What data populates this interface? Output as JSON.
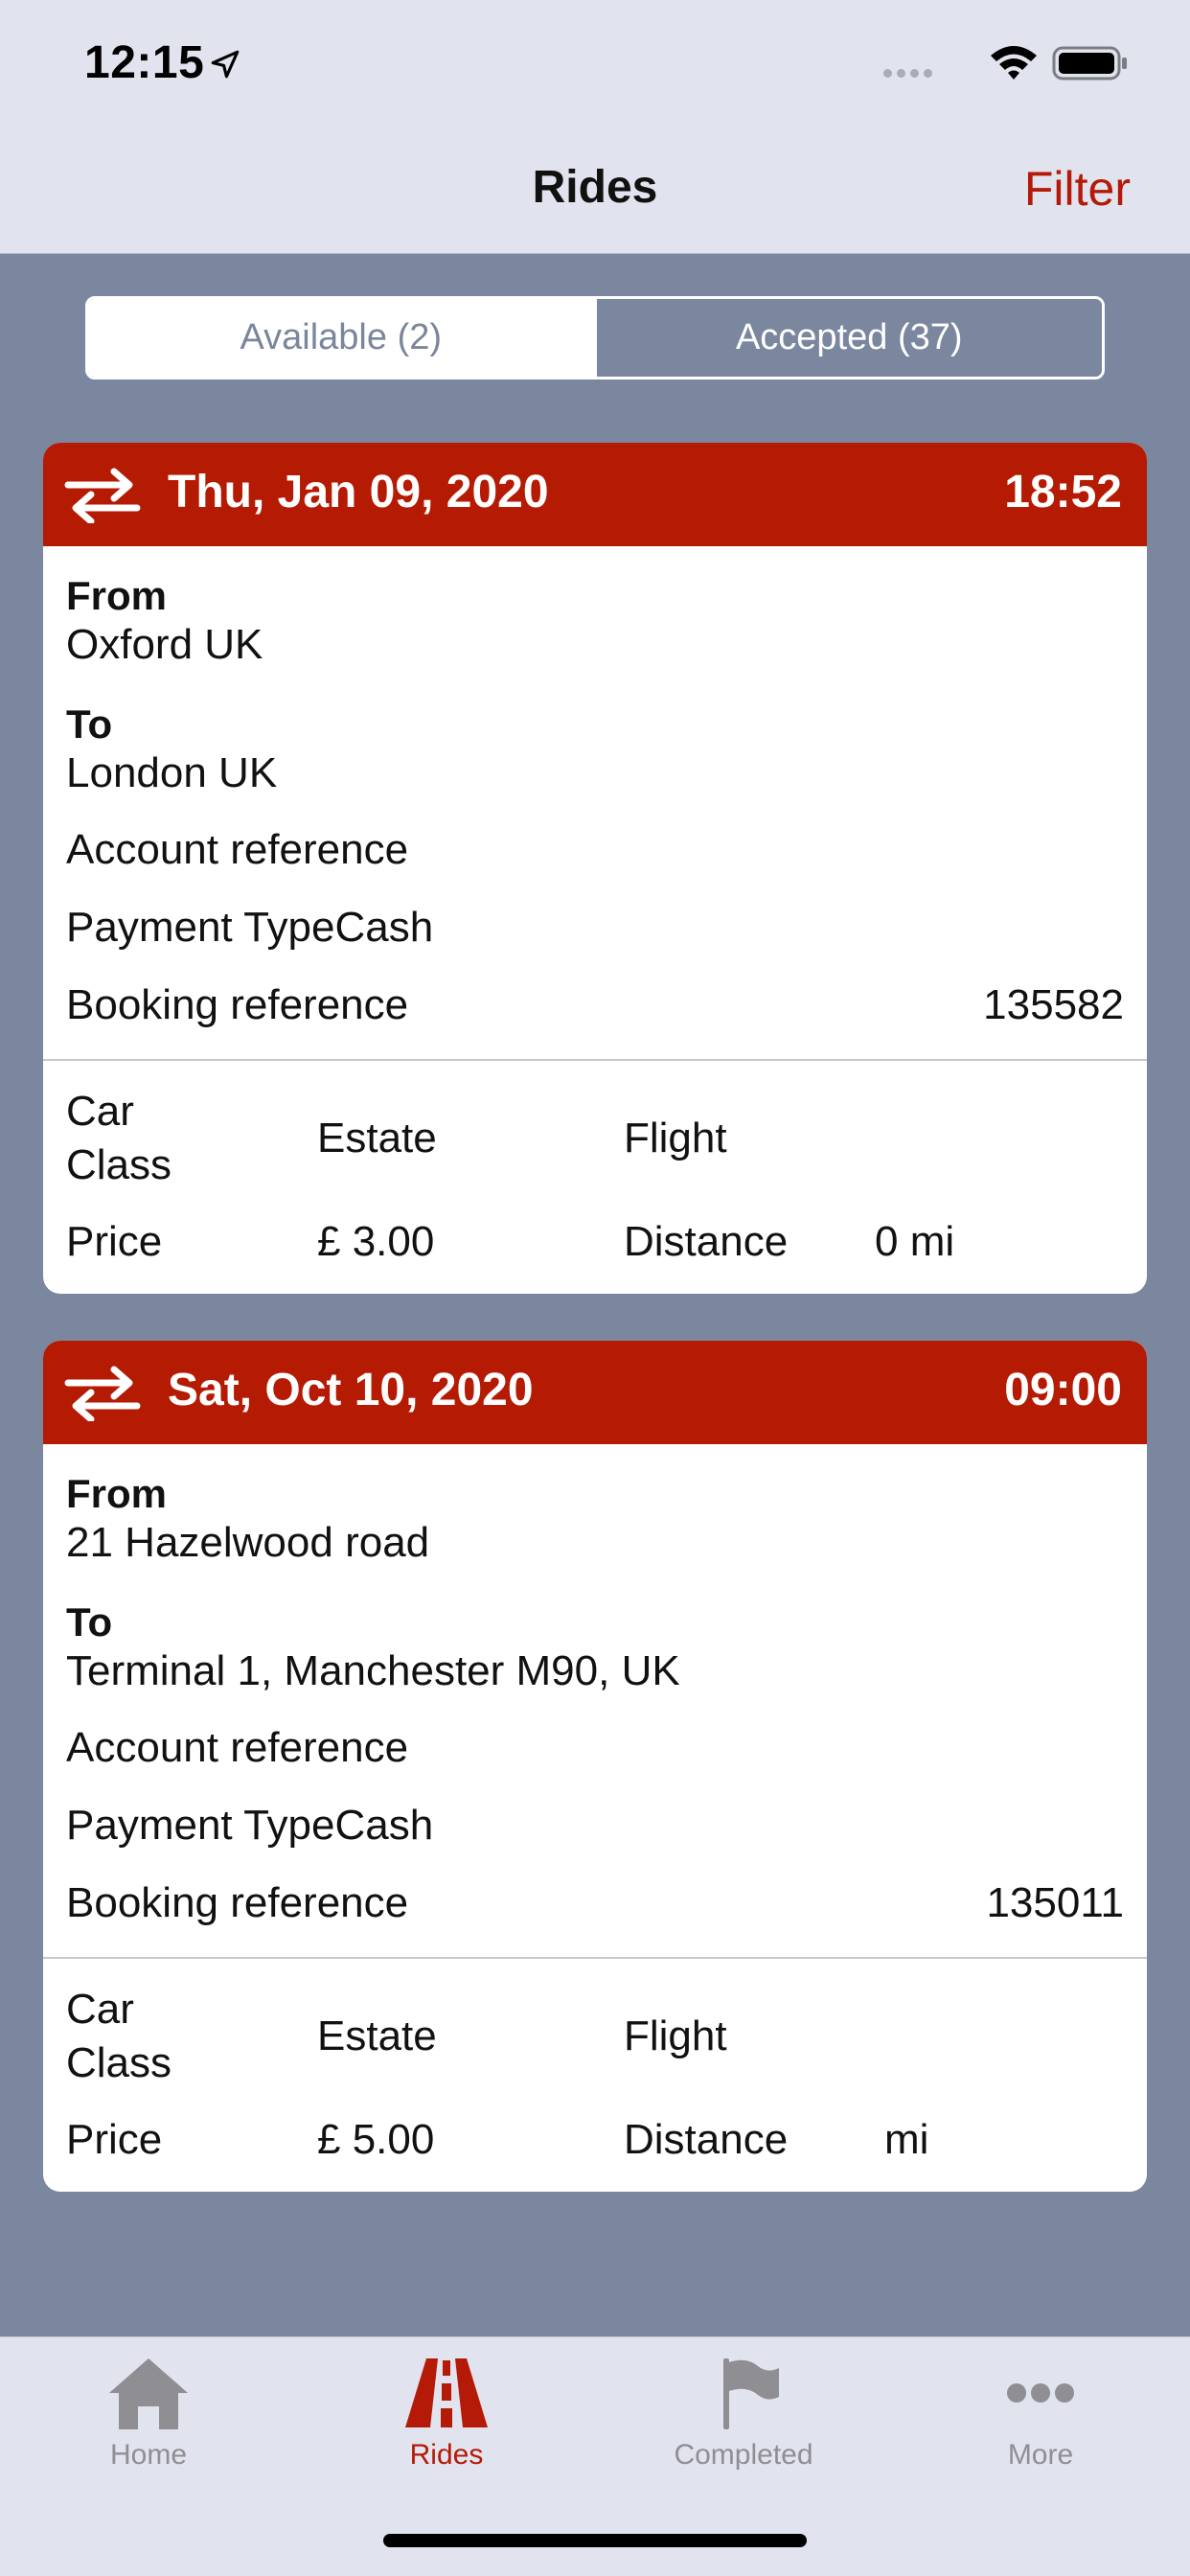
{
  "status_bar": {
    "time": "12:15"
  },
  "nav": {
    "title": "Rides",
    "filter_label": "Filter"
  },
  "segments": {
    "available": "Available (2)",
    "accepted": "Accepted (37)"
  },
  "rides": [
    {
      "date": "Thu, Jan 09, 2020",
      "time": "18:52",
      "from_label": "From",
      "from": "Oxford  UK",
      "to_label": "To",
      "to": "London  UK",
      "account_reference_label": "Account reference",
      "payment_type_label": "Payment TypeCash",
      "booking_reference_label": "Booking reference",
      "booking_reference": "135582",
      "car_class_label": "Car Class",
      "car_class": "Estate",
      "flight_label": "Flight",
      "price_label": "Price",
      "price": "£ 3.00",
      "distance_label": "Distance",
      "distance": "0 mi"
    },
    {
      "date": "Sat, Oct 10, 2020",
      "time": "09:00",
      "from_label": "From",
      "from": "21 Hazelwood road",
      "to_label": "To",
      "to": "Terminal 1, Manchester M90, UK",
      "account_reference_label": "Account reference",
      "payment_type_label": "Payment TypeCash",
      "booking_reference_label": "Booking reference",
      "booking_reference": "135011",
      "car_class_label": "Car Class",
      "car_class": "Estate",
      "flight_label": "Flight",
      "price_label": "Price",
      "price": "£ 5.00",
      "distance_label": "Distance",
      "distance": "mi"
    }
  ],
  "tabs": [
    {
      "label": "Home",
      "icon": "home-icon",
      "active": false
    },
    {
      "label": "Rides",
      "icon": "road-icon",
      "active": true
    },
    {
      "label": "Completed",
      "icon": "flag-icon",
      "active": false
    },
    {
      "label": "More",
      "icon": "more-icon",
      "active": false
    }
  ],
  "colors": {
    "accent": "#b51a02",
    "background": "#7b879f",
    "bar": "#e1e4ee",
    "inactive_tab": "#8e8e93"
  }
}
